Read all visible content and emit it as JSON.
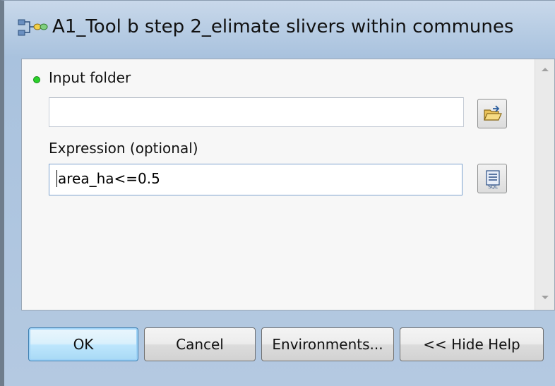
{
  "window": {
    "title": "A1_Tool b step 2_elimate slivers within communes",
    "title_icon": "model-tool-icon"
  },
  "form": {
    "input_folder": {
      "label": "Input folder",
      "required": true,
      "value": "",
      "browse_icon": "open-folder-icon"
    },
    "expression": {
      "label": "Expression (optional)",
      "value": "area_ha<=0.5",
      "builder_icon": "sql-icon"
    }
  },
  "buttons": {
    "ok": "OK",
    "cancel": "Cancel",
    "environments": "Environments...",
    "hide_help": "<< Hide Help"
  },
  "colors": {
    "required_indicator": "#2bd12b",
    "default_button_border": "#3c7fb1"
  }
}
